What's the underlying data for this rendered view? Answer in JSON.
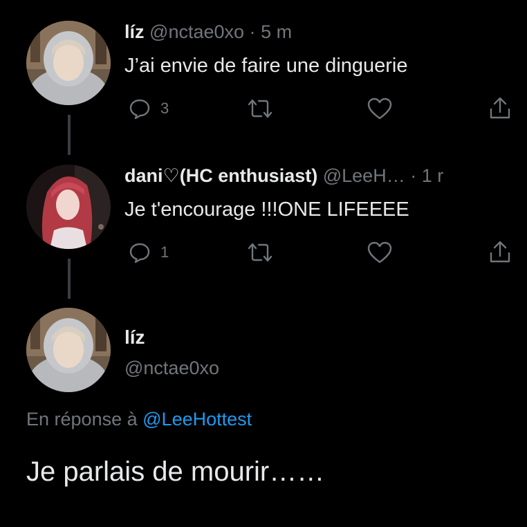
{
  "tweets": [
    {
      "name": "líz",
      "handle": "@nctae0xo",
      "separator": "·",
      "time": "5 m",
      "text": "J’ai envie de faire une dinguerie",
      "reply_count": "3"
    },
    {
      "name": "dani♡(HC enthusiast)",
      "handle": "@LeeH…",
      "separator": "·",
      "time": "1 r",
      "text": "Je t'encourage !!!ONE LIFEEEE",
      "reply_count": "1"
    }
  ],
  "main_tweet": {
    "name": "líz",
    "handle": "@nctae0xo",
    "reply_prefix": "En réponse à",
    "reply_mention": "@LeeHottest",
    "text": "Je parlais de mourir……"
  },
  "icons": {
    "reply": "reply-icon",
    "retweet": "retweet-icon",
    "like": "heart-icon",
    "share": "share-icon"
  },
  "colors": {
    "background": "#000000",
    "text": "#e7e9ea",
    "muted": "#71767b",
    "link": "#1d9bf0"
  }
}
